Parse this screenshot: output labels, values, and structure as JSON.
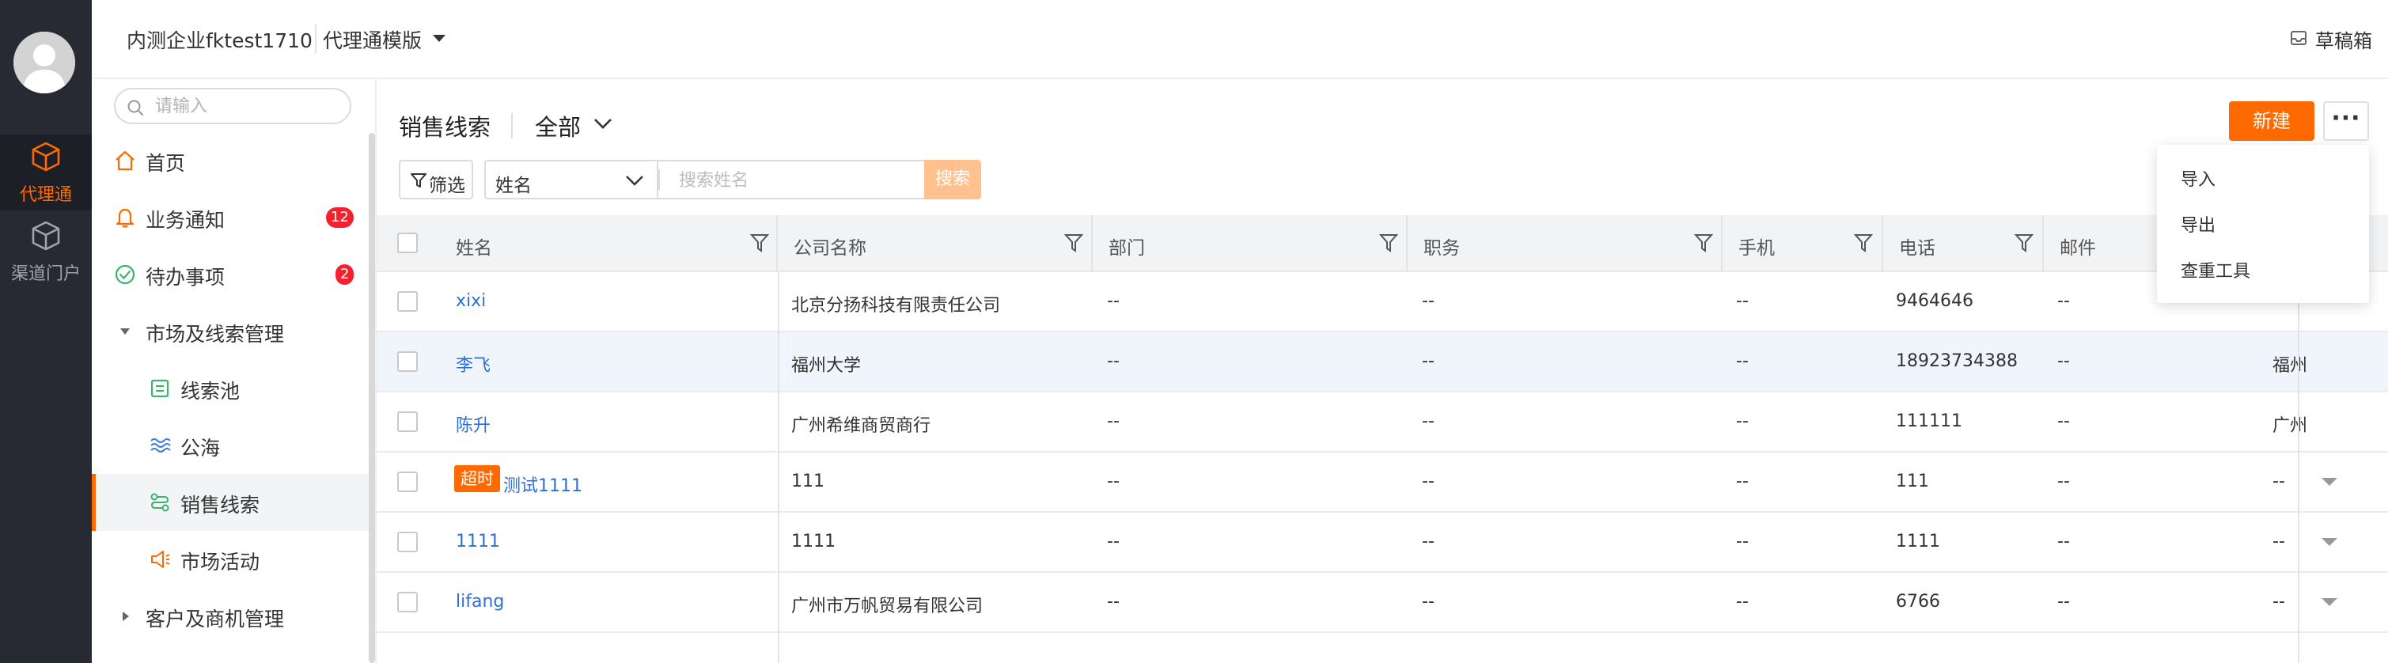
{
  "rail": {
    "items": [
      {
        "label": "代理通",
        "icon": "cube-icon",
        "active": true
      },
      {
        "label": "渠道门户",
        "icon": "cube-icon",
        "active": false
      }
    ]
  },
  "topbar": {
    "company": "内测企业fktest1710",
    "template": "代理通模版",
    "drafts": "草稿箱"
  },
  "sidebar": {
    "search_placeholder": "请输入",
    "items": [
      {
        "label": "首页",
        "icon": "home-icon"
      },
      {
        "label": "业务通知",
        "icon": "bell-icon",
        "badge": "12"
      },
      {
        "label": "待办事项",
        "icon": "check-circle-icon",
        "badge": "2"
      },
      {
        "label": "市场及线索管理",
        "icon": "caret-down-icon",
        "expanded": true
      },
      {
        "label": "线索池",
        "icon": "list-icon"
      },
      {
        "label": "公海",
        "icon": "waves-icon"
      },
      {
        "label": "销售线索",
        "icon": "flow-icon",
        "active": true
      },
      {
        "label": "市场活动",
        "icon": "megaphone-icon"
      },
      {
        "label": "客户及商机管理",
        "icon": "caret-right-icon",
        "expanded": false
      }
    ]
  },
  "content": {
    "title": "销售线索",
    "scope": "全部",
    "new_label": "新建",
    "more_label": "···",
    "filter_label": "筛选",
    "field_select": "姓名",
    "search_placeholder": "搜索姓名",
    "search_label": "搜索"
  },
  "menu": {
    "items": [
      "导入",
      "导出",
      "查重工具"
    ]
  },
  "table": {
    "columns": [
      "姓名",
      "公司名称",
      "部门",
      "职务",
      "手机",
      "电话",
      "邮件"
    ],
    "rows": [
      {
        "name": "xixi",
        "company": "北京分扬科技有限责任公司",
        "dept": "--",
        "title": "--",
        "mobile": "--",
        "phone": "9464646",
        "email": "--",
        "extra": "--"
      },
      {
        "name": "李飞",
        "company": "福州大学",
        "dept": "--",
        "title": "--",
        "mobile": "--",
        "phone": "18923734388",
        "email": "--",
        "extra": "福州"
      },
      {
        "name": "陈升",
        "company": "广州希维商贸商行",
        "dept": "--",
        "title": "--",
        "mobile": "--",
        "phone": "111111",
        "email": "--",
        "extra": "广州"
      },
      {
        "name": "测试1111",
        "tag": "超时",
        "company": "111",
        "dept": "--",
        "title": "--",
        "mobile": "--",
        "phone": "111",
        "email": "--",
        "extra": "--"
      },
      {
        "name": "1111",
        "company": "1111",
        "dept": "--",
        "title": "--",
        "mobile": "--",
        "phone": "1111",
        "email": "--",
        "extra": "--"
      },
      {
        "name": "lifang",
        "company": "广州市万帆贸易有限公司",
        "dept": "--",
        "title": "--",
        "mobile": "--",
        "phone": "6766",
        "email": "--",
        "extra": "--"
      }
    ]
  },
  "colors": {
    "accent": "#ff6a00",
    "rail_bg": "#272a33",
    "link": "#2f6fd6",
    "badge": "#f5222d",
    "green_icon": "#3bb36b",
    "blue_icon": "#3a7bd5"
  }
}
